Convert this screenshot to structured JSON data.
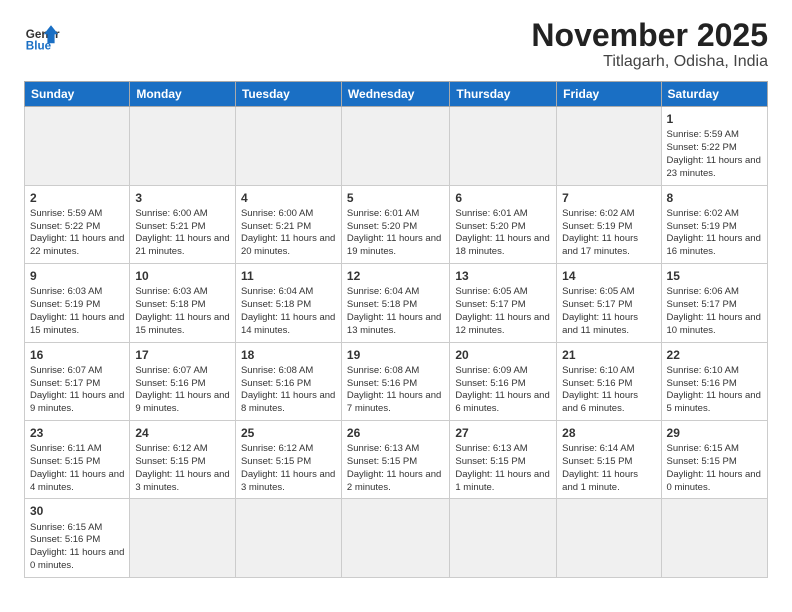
{
  "header": {
    "logo_general": "General",
    "logo_blue": "Blue",
    "month": "November 2025",
    "location": "Titlagarh, Odisha, India"
  },
  "days_of_week": [
    "Sunday",
    "Monday",
    "Tuesday",
    "Wednesday",
    "Thursday",
    "Friday",
    "Saturday"
  ],
  "weeks": [
    [
      {
        "day": "",
        "empty": true
      },
      {
        "day": "",
        "empty": true
      },
      {
        "day": "",
        "empty": true
      },
      {
        "day": "",
        "empty": true
      },
      {
        "day": "",
        "empty": true
      },
      {
        "day": "",
        "empty": true
      },
      {
        "day": "1",
        "sunrise": "5:59 AM",
        "sunset": "5:22 PM",
        "daylight": "11 hours and 23 minutes."
      }
    ],
    [
      {
        "day": "2",
        "sunrise": "5:59 AM",
        "sunset": "5:22 PM",
        "daylight": "11 hours and 22 minutes."
      },
      {
        "day": "3",
        "sunrise": "6:00 AM",
        "sunset": "5:21 PM",
        "daylight": "11 hours and 21 minutes."
      },
      {
        "day": "4",
        "sunrise": "6:00 AM",
        "sunset": "5:21 PM",
        "daylight": "11 hours and 20 minutes."
      },
      {
        "day": "5",
        "sunrise": "6:01 AM",
        "sunset": "5:20 PM",
        "daylight": "11 hours and 19 minutes."
      },
      {
        "day": "6",
        "sunrise": "6:01 AM",
        "sunset": "5:20 PM",
        "daylight": "11 hours and 18 minutes."
      },
      {
        "day": "7",
        "sunrise": "6:02 AM",
        "sunset": "5:19 PM",
        "daylight": "11 hours and 17 minutes."
      },
      {
        "day": "8",
        "sunrise": "6:02 AM",
        "sunset": "5:19 PM",
        "daylight": "11 hours and 16 minutes."
      }
    ],
    [
      {
        "day": "9",
        "sunrise": "6:03 AM",
        "sunset": "5:19 PM",
        "daylight": "11 hours and 15 minutes."
      },
      {
        "day": "10",
        "sunrise": "6:03 AM",
        "sunset": "5:18 PM",
        "daylight": "11 hours and 15 minutes."
      },
      {
        "day": "11",
        "sunrise": "6:04 AM",
        "sunset": "5:18 PM",
        "daylight": "11 hours and 14 minutes."
      },
      {
        "day": "12",
        "sunrise": "6:04 AM",
        "sunset": "5:18 PM",
        "daylight": "11 hours and 13 minutes."
      },
      {
        "day": "13",
        "sunrise": "6:05 AM",
        "sunset": "5:17 PM",
        "daylight": "11 hours and 12 minutes."
      },
      {
        "day": "14",
        "sunrise": "6:05 AM",
        "sunset": "5:17 PM",
        "daylight": "11 hours and 11 minutes."
      },
      {
        "day": "15",
        "sunrise": "6:06 AM",
        "sunset": "5:17 PM",
        "daylight": "11 hours and 10 minutes."
      }
    ],
    [
      {
        "day": "16",
        "sunrise": "6:07 AM",
        "sunset": "5:17 PM",
        "daylight": "11 hours and 9 minutes."
      },
      {
        "day": "17",
        "sunrise": "6:07 AM",
        "sunset": "5:16 PM",
        "daylight": "11 hours and 9 minutes."
      },
      {
        "day": "18",
        "sunrise": "6:08 AM",
        "sunset": "5:16 PM",
        "daylight": "11 hours and 8 minutes."
      },
      {
        "day": "19",
        "sunrise": "6:08 AM",
        "sunset": "5:16 PM",
        "daylight": "11 hours and 7 minutes."
      },
      {
        "day": "20",
        "sunrise": "6:09 AM",
        "sunset": "5:16 PM",
        "daylight": "11 hours and 6 minutes."
      },
      {
        "day": "21",
        "sunrise": "6:10 AM",
        "sunset": "5:16 PM",
        "daylight": "11 hours and 6 minutes."
      },
      {
        "day": "22",
        "sunrise": "6:10 AM",
        "sunset": "5:16 PM",
        "daylight": "11 hours and 5 minutes."
      }
    ],
    [
      {
        "day": "23",
        "sunrise": "6:11 AM",
        "sunset": "5:15 PM",
        "daylight": "11 hours and 4 minutes."
      },
      {
        "day": "24",
        "sunrise": "6:12 AM",
        "sunset": "5:15 PM",
        "daylight": "11 hours and 3 minutes."
      },
      {
        "day": "25",
        "sunrise": "6:12 AM",
        "sunset": "5:15 PM",
        "daylight": "11 hours and 3 minutes."
      },
      {
        "day": "26",
        "sunrise": "6:13 AM",
        "sunset": "5:15 PM",
        "daylight": "11 hours and 2 minutes."
      },
      {
        "day": "27",
        "sunrise": "6:13 AM",
        "sunset": "5:15 PM",
        "daylight": "11 hours and 1 minute."
      },
      {
        "day": "28",
        "sunrise": "6:14 AM",
        "sunset": "5:15 PM",
        "daylight": "11 hours and 1 minute."
      },
      {
        "day": "29",
        "sunrise": "6:15 AM",
        "sunset": "5:15 PM",
        "daylight": "11 hours and 0 minutes."
      }
    ],
    [
      {
        "day": "30",
        "sunrise": "6:15 AM",
        "sunset": "5:16 PM",
        "daylight": "11 hours and 0 minutes."
      },
      {
        "day": "",
        "empty": true
      },
      {
        "day": "",
        "empty": true
      },
      {
        "day": "",
        "empty": true
      },
      {
        "day": "",
        "empty": true
      },
      {
        "day": "",
        "empty": true
      },
      {
        "day": "",
        "empty": true
      }
    ]
  ]
}
